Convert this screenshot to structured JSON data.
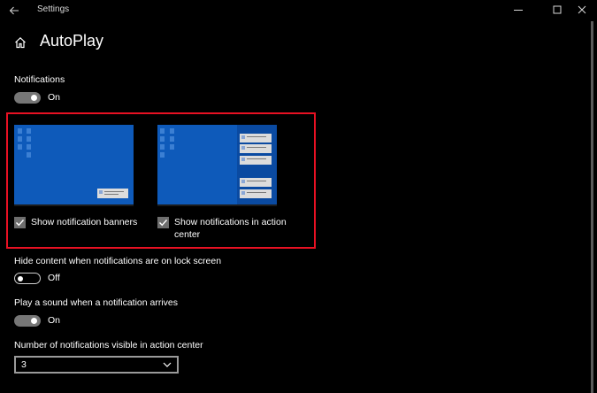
{
  "window": {
    "title": "Settings",
    "back_icon": "arrow-left-icon",
    "minimize_icon": "minimize-icon",
    "maximize_icon": "maximize-icon",
    "close_icon": "close-icon"
  },
  "header": {
    "home_icon": "home-icon",
    "title": "AutoPlay"
  },
  "notifications": {
    "label": "Notifications",
    "toggle_state": "On",
    "toggle_on": true
  },
  "previews": [
    {
      "checkbox_label": "Show notification banners",
      "checked": true
    },
    {
      "checkbox_label": "Show notifications in action center",
      "checked": true
    }
  ],
  "lock_screen": {
    "label": "Hide content when notifications are on lock screen",
    "toggle_state": "Off",
    "toggle_on": false
  },
  "sound": {
    "label": "Play a sound when a notification arrives",
    "toggle_state": "On",
    "toggle_on": true
  },
  "action_center_count": {
    "label": "Number of notifications visible in action center",
    "selected": "3",
    "dropdown_icon": "chevron-down-icon"
  },
  "colors": {
    "background": "#000000",
    "desktop_blue": "#0e5aba",
    "highlight_red": "#e81123",
    "toggle_on_track": "#767676"
  }
}
